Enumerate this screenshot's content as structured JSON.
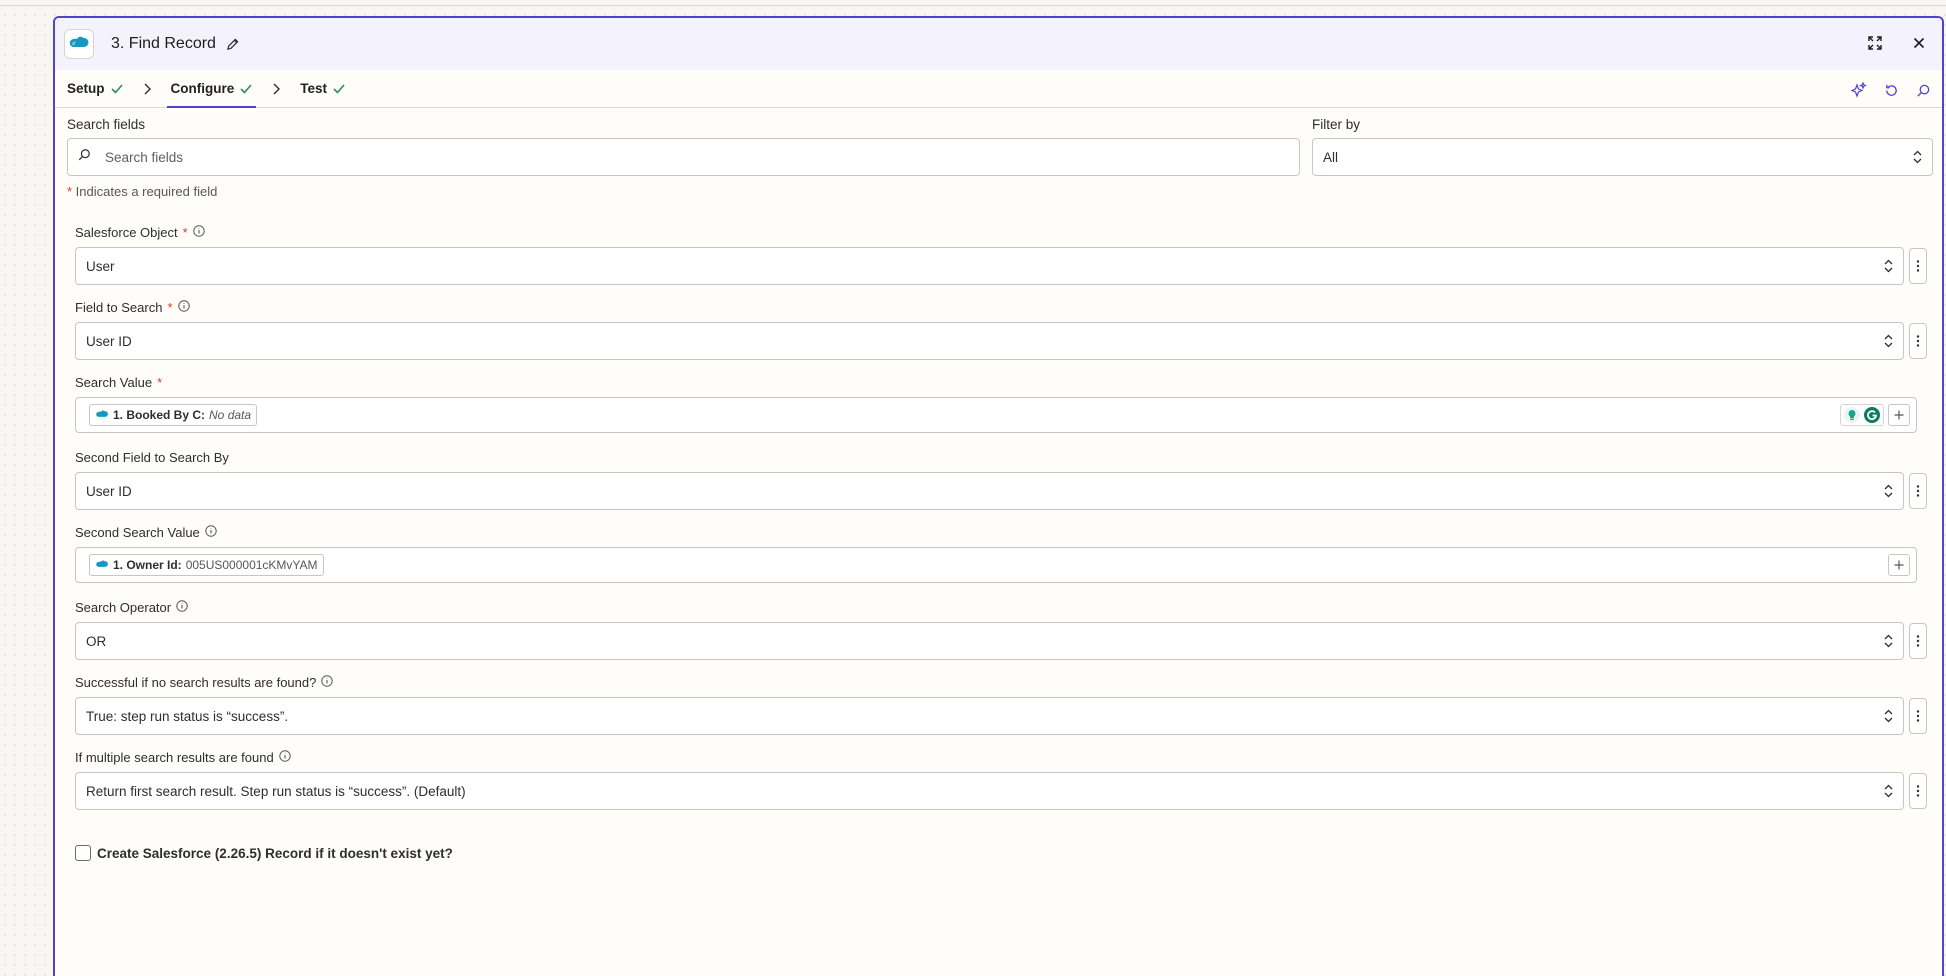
{
  "header": {
    "title": "3. Find Record",
    "actions": [
      "expand-icon",
      "close-icon"
    ]
  },
  "tabs": [
    {
      "label": "Setup",
      "complete": true
    },
    {
      "label": "Configure",
      "complete": true,
      "active": true
    },
    {
      "label": "Test",
      "complete": true
    }
  ],
  "search": {
    "label": "Search fields",
    "placeholder": "Search fields"
  },
  "filter": {
    "label": "Filter by",
    "value": "All"
  },
  "required_note": {
    "star": "*",
    "text": " Indicates a required field"
  },
  "fields": {
    "salesforce_object": {
      "label": "Salesforce Object",
      "required": "*",
      "value": "User"
    },
    "field_to_search": {
      "label": "Field to Search",
      "required": "*",
      "value": "User ID"
    },
    "search_value": {
      "label": "Search Value",
      "required": "*",
      "token_label": "1. Booked By C:",
      "token_value": "No data"
    },
    "second_field": {
      "label": "Second Field to Search By",
      "value": "User ID"
    },
    "second_search_value": {
      "label": "Second Search Value",
      "token_label": "1. Owner Id:",
      "token_value": "005US000001cKMvYAM"
    },
    "search_operator": {
      "label": "Search Operator",
      "value": "OR"
    },
    "successful_if_none": {
      "label": "Successful if no search results are found?",
      "value": "True: step run status is “success”."
    },
    "multiple_results": {
      "label": "If multiple search results are found",
      "value": "Return first search result. Step run status is “success”. (Default)"
    }
  },
  "create_if_missing": {
    "label": "Create Salesforce (2.26.5) Record if it doesn't exist yet?",
    "checked": false
  },
  "colors": {
    "accent": "#5244c9",
    "success_check": "#2e8b57",
    "required": "#d83a2e",
    "salesforce": "#1798c1"
  }
}
